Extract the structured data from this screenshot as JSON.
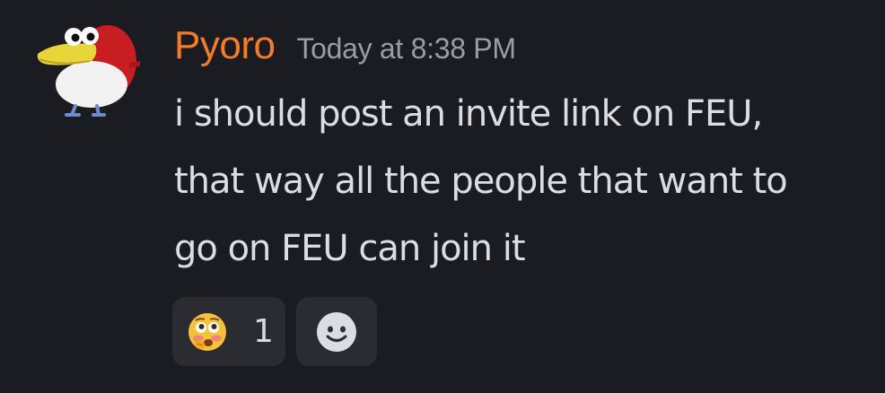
{
  "message": {
    "author": {
      "username": "Pyoro",
      "username_color": "#f47b2a",
      "avatar_icon": "pyoro-bird-avatar"
    },
    "timestamp": "Today at 8:38 PM",
    "lines": [
      "i should post an invite link on FEU,",
      "that way all the people that want to",
      "go on FEU can join it"
    ],
    "reactions": [
      {
        "emoji_icon": "thinking-flushed-face-emoji",
        "count": "1"
      }
    ],
    "add_reaction_icon": "smiley-face-icon"
  }
}
